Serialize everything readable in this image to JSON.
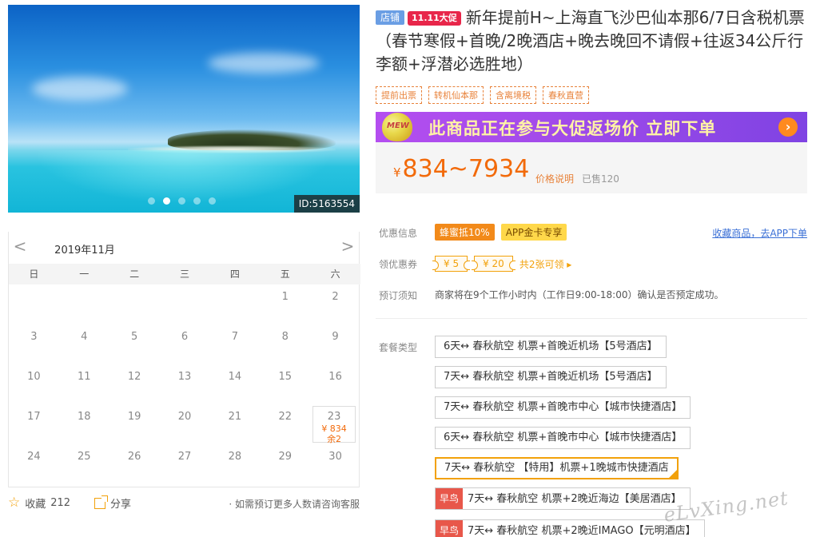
{
  "gallery": {
    "image_id": "ID:5163554",
    "dot_count": 5,
    "active_dot": 1
  },
  "calendar": {
    "month": "2019年11月",
    "prev": "<",
    "next": ">",
    "weekdays": [
      "日",
      "一",
      "二",
      "三",
      "四",
      "五",
      "六"
    ],
    "weeks": [
      [
        null,
        null,
        null,
        null,
        null,
        {
          "day": "1"
        },
        {
          "day": "2"
        }
      ],
      [
        {
          "day": "3"
        },
        {
          "day": "4"
        },
        {
          "day": "5"
        },
        {
          "day": "6"
        },
        {
          "day": "7"
        },
        {
          "day": "8"
        },
        {
          "day": "9"
        }
      ],
      [
        {
          "day": "10"
        },
        {
          "day": "11"
        },
        {
          "day": "12"
        },
        {
          "day": "13"
        },
        {
          "day": "14"
        },
        {
          "day": "15"
        },
        {
          "day": "16"
        }
      ],
      [
        {
          "day": "17"
        },
        {
          "day": "18"
        },
        {
          "day": "19"
        },
        {
          "day": "20"
        },
        {
          "day": "21"
        },
        {
          "day": "22"
        },
        {
          "day": "23",
          "price": "¥ 834",
          "stock": "余2"
        }
      ],
      [
        {
          "day": "24"
        },
        {
          "day": "25"
        },
        {
          "day": "26"
        },
        {
          "day": "27"
        },
        {
          "day": "28"
        },
        {
          "day": "29"
        },
        {
          "day": "30"
        }
      ]
    ]
  },
  "bottom": {
    "favorite_label": "收藏",
    "favorite_count": "212",
    "share_label": "分享",
    "note": "· 如需预订更多人数请咨询客服"
  },
  "product": {
    "shop_tag": "店铺",
    "event_tag": "11.11大促",
    "title": "新年提前H~上海直飞沙巴仙本那6/7日含税机票（春节寒假+首晚/2晚酒店+晚去晚回不请假+往返34公斤行李额+浮潜必选胜地）",
    "feature_tags": [
      "提前出票",
      "转机仙本那",
      "含离境税",
      "春秋直营"
    ],
    "promo_badge": "MEW",
    "promo_text": "此商品正在参与大促返场价 立即下单",
    "price_symbol": "¥",
    "price": "834~7934",
    "price_note": "价格说明",
    "sold": "已售120"
  },
  "info": {
    "discount_label": "优惠信息",
    "discount_badges": [
      "蜂蜜抵10%",
      "APP金卡专享"
    ],
    "fav_app_link": "收藏商品，去APP下单",
    "coupon_label": "领优惠券",
    "coupons": [
      "¥ 5",
      "¥ 20"
    ],
    "coupon_more": "共2张可领 ▸",
    "notice_label": "预订须知",
    "notice_text": "商家将在9个工作小时内（工作日9:00-18:00）确认是否预定成功。",
    "package_label": "套餐类型"
  },
  "packages": [
    {
      "text": "6天↔ 春秋航空 机票+首晚近机场【5号酒店】",
      "early": "",
      "selected": false
    },
    {
      "text": "7天↔ 春秋航空 机票+首晚近机场【5号酒店】",
      "early": "",
      "selected": false
    },
    {
      "text": "7天↔ 春秋航空 机票+首晚市中心【城市快捷酒店】",
      "early": "",
      "selected": false
    },
    {
      "text": "6天↔ 春秋航空 机票+首晚市中心【城市快捷酒店】",
      "early": "",
      "selected": false
    },
    {
      "text": "7天↔ 春秋航空 【特用】机票+1晚城市快捷酒店",
      "early": "",
      "selected": true
    },
    {
      "text": "7天↔ 春秋航空 机票+2晚近海边【美居酒店】",
      "early": "早鸟",
      "selected": false
    },
    {
      "text": "7天↔ 春秋航空 机票+2晚近IMAGO【元明酒店】",
      "early": "早鸟",
      "selected": false
    }
  ],
  "watermark": "eLvXing.net"
}
